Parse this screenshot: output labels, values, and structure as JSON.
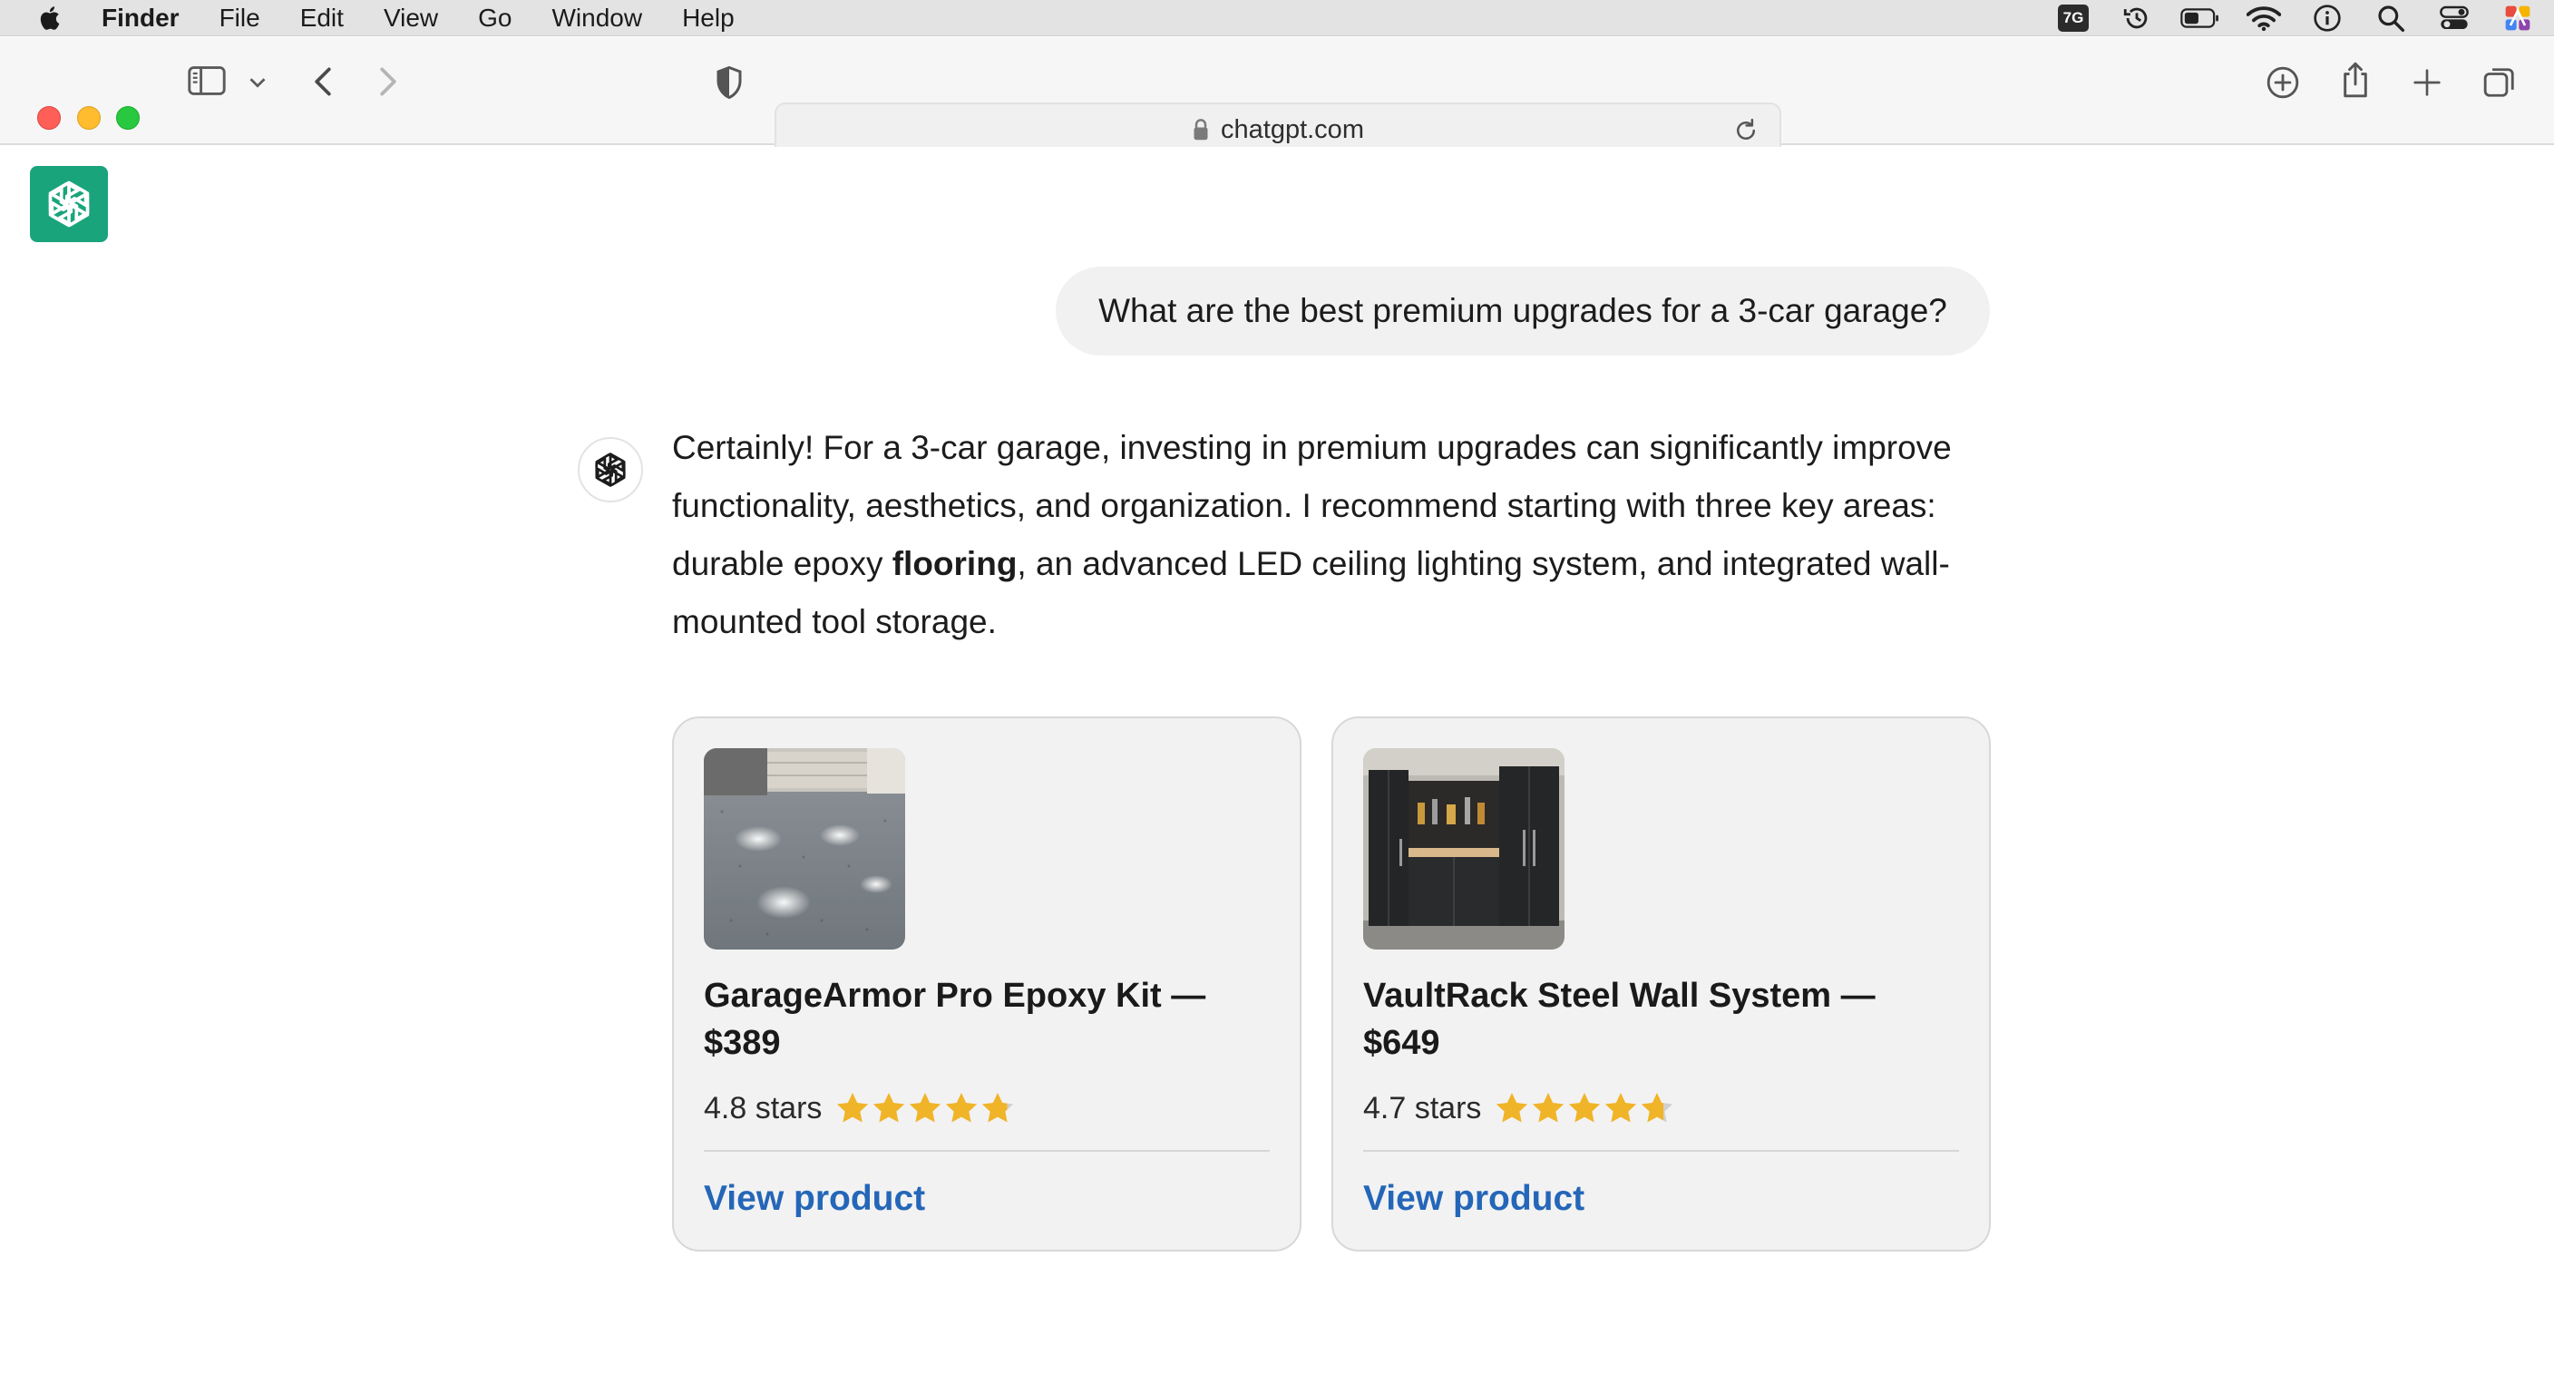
{
  "menubar": {
    "items": [
      {
        "label": "Finder"
      },
      {
        "label": "File"
      },
      {
        "label": "Edit"
      },
      {
        "label": "View"
      },
      {
        "label": "Go"
      },
      {
        "label": "Window"
      },
      {
        "label": "Help"
      }
    ],
    "status_badge": "7G",
    "status_icons": [
      "time-machine-icon",
      "battery-icon",
      "wifi-icon",
      "info-icon",
      "spotlight-search-icon",
      "control-center-icon",
      "siri-icon"
    ]
  },
  "browser": {
    "address": "chatgpt.com",
    "toolbar_icons": [
      "sidebar-icon",
      "chevron-down-icon",
      "back-icon",
      "forward-icon",
      "privacy-shield-icon",
      "lock-icon",
      "reload-icon",
      "download-icon",
      "share-icon",
      "new-tab-icon",
      "tab-overview-icon"
    ]
  },
  "chat": {
    "user_message": "What are the best premium upgrades for a 3-car garage?",
    "assistant_message": {
      "part1": "Certainly! For a 3-car garage, investing in premium upgrades can significantly improve functionality, aesthetics, and organization. I recommend starting with three key areas: durable epoxy ",
      "bold": "flooring",
      "part2": ", an advanced LED ceiling lighting system, and integrated wall-mounted tool storage."
    }
  },
  "products": [
    {
      "title": "GarageArmor Pro Epoxy Kit — $389",
      "rating_text": "4.8 stars",
      "rating": 4.8,
      "link_label": "View product"
    },
    {
      "title": "VaultRack Steel Wall System — $649",
      "rating_text": "4.7 stars",
      "rating": 4.7,
      "link_label": "View product"
    }
  ],
  "colors": {
    "brand_green": "#19a47c",
    "link_blue": "#2466b8",
    "star_gold": "#f0b429",
    "star_empty": "#d0d0d0"
  }
}
